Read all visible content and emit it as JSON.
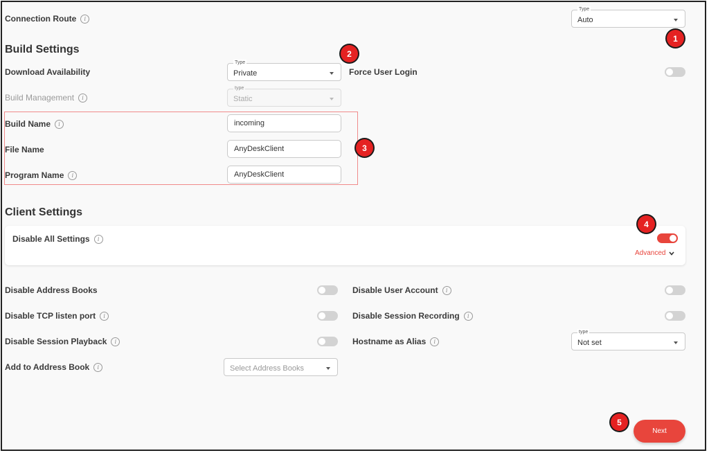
{
  "connection_route": {
    "label": "Connection Route",
    "type_legend": "Type",
    "value": "Auto"
  },
  "build_settings": {
    "title": "Build Settings",
    "download_availability": {
      "label": "Download Availability",
      "type_legend": "Type",
      "value": "Private"
    },
    "force_user_login": {
      "label": "Force User Login",
      "enabled": false
    },
    "build_management": {
      "label": "Build Management",
      "type_legend": "type",
      "value": "Static"
    },
    "build_name": {
      "label": "Build Name",
      "value": "incoming"
    },
    "file_name": {
      "label": "File Name",
      "value": "AnyDeskClient"
    },
    "program_name": {
      "label": "Program Name",
      "value": "AnyDeskClient"
    }
  },
  "client_settings": {
    "title": "Client Settings",
    "disable_all_settings": {
      "label": "Disable All Settings",
      "enabled": true
    },
    "advanced_label": "Advanced",
    "disable_address_books": {
      "label": "Disable Address Books",
      "enabled": false
    },
    "disable_user_account": {
      "label": "Disable User Account",
      "enabled": false
    },
    "disable_tcp_listen_port": {
      "label": "Disable TCP listen port",
      "enabled": false
    },
    "disable_session_recording": {
      "label": "Disable Session Recording",
      "enabled": false
    },
    "disable_session_playback": {
      "label": "Disable Session Playback",
      "enabled": false
    },
    "hostname_as_alias": {
      "label": "Hostname as Alias",
      "type_legend": "type",
      "value": "Not set"
    },
    "add_to_address_book": {
      "label": "Add to Address Book",
      "placeholder": "Select Address Books"
    }
  },
  "next_label": "Next",
  "badges": [
    "1",
    "2",
    "3",
    "4",
    "5"
  ],
  "info_glyph": "i",
  "colors": {
    "accent": "#e8453c",
    "badge": "#e52222",
    "highlight": "#f08a8a"
  }
}
